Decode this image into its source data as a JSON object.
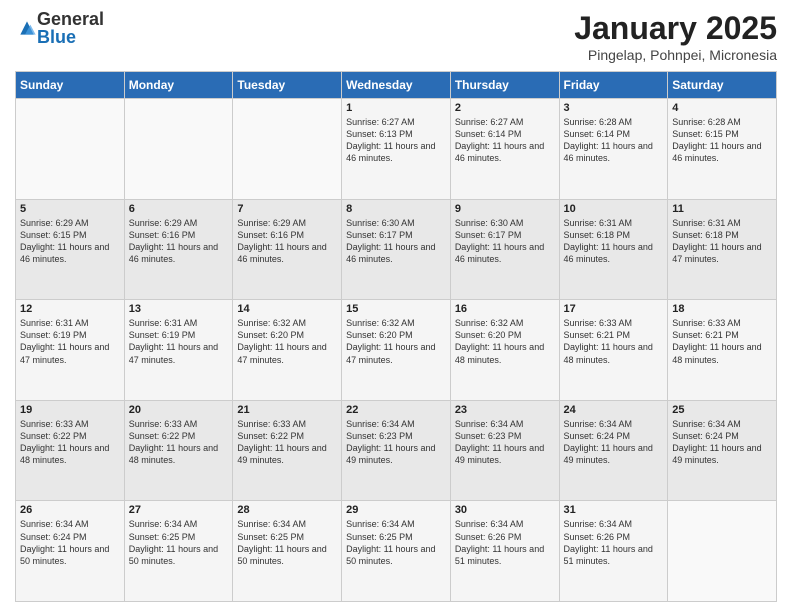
{
  "header": {
    "logo_general": "General",
    "logo_blue": "Blue",
    "title": "January 2025",
    "subtitle": "Pingelap, Pohnpei, Micronesia"
  },
  "weekdays": [
    "Sunday",
    "Monday",
    "Tuesday",
    "Wednesday",
    "Thursday",
    "Friday",
    "Saturday"
  ],
  "weeks": [
    [
      {
        "day": "",
        "info": ""
      },
      {
        "day": "",
        "info": ""
      },
      {
        "day": "",
        "info": ""
      },
      {
        "day": "1",
        "info": "Sunrise: 6:27 AM\nSunset: 6:13 PM\nDaylight: 11 hours and 46 minutes."
      },
      {
        "day": "2",
        "info": "Sunrise: 6:27 AM\nSunset: 6:14 PM\nDaylight: 11 hours and 46 minutes."
      },
      {
        "day": "3",
        "info": "Sunrise: 6:28 AM\nSunset: 6:14 PM\nDaylight: 11 hours and 46 minutes."
      },
      {
        "day": "4",
        "info": "Sunrise: 6:28 AM\nSunset: 6:15 PM\nDaylight: 11 hours and 46 minutes."
      }
    ],
    [
      {
        "day": "5",
        "info": "Sunrise: 6:29 AM\nSunset: 6:15 PM\nDaylight: 11 hours and 46 minutes."
      },
      {
        "day": "6",
        "info": "Sunrise: 6:29 AM\nSunset: 6:16 PM\nDaylight: 11 hours and 46 minutes."
      },
      {
        "day": "7",
        "info": "Sunrise: 6:29 AM\nSunset: 6:16 PM\nDaylight: 11 hours and 46 minutes."
      },
      {
        "day": "8",
        "info": "Sunrise: 6:30 AM\nSunset: 6:17 PM\nDaylight: 11 hours and 46 minutes."
      },
      {
        "day": "9",
        "info": "Sunrise: 6:30 AM\nSunset: 6:17 PM\nDaylight: 11 hours and 46 minutes."
      },
      {
        "day": "10",
        "info": "Sunrise: 6:31 AM\nSunset: 6:18 PM\nDaylight: 11 hours and 46 minutes."
      },
      {
        "day": "11",
        "info": "Sunrise: 6:31 AM\nSunset: 6:18 PM\nDaylight: 11 hours and 47 minutes."
      }
    ],
    [
      {
        "day": "12",
        "info": "Sunrise: 6:31 AM\nSunset: 6:19 PM\nDaylight: 11 hours and 47 minutes."
      },
      {
        "day": "13",
        "info": "Sunrise: 6:31 AM\nSunset: 6:19 PM\nDaylight: 11 hours and 47 minutes."
      },
      {
        "day": "14",
        "info": "Sunrise: 6:32 AM\nSunset: 6:20 PM\nDaylight: 11 hours and 47 minutes."
      },
      {
        "day": "15",
        "info": "Sunrise: 6:32 AM\nSunset: 6:20 PM\nDaylight: 11 hours and 47 minutes."
      },
      {
        "day": "16",
        "info": "Sunrise: 6:32 AM\nSunset: 6:20 PM\nDaylight: 11 hours and 48 minutes."
      },
      {
        "day": "17",
        "info": "Sunrise: 6:33 AM\nSunset: 6:21 PM\nDaylight: 11 hours and 48 minutes."
      },
      {
        "day": "18",
        "info": "Sunrise: 6:33 AM\nSunset: 6:21 PM\nDaylight: 11 hours and 48 minutes."
      }
    ],
    [
      {
        "day": "19",
        "info": "Sunrise: 6:33 AM\nSunset: 6:22 PM\nDaylight: 11 hours and 48 minutes."
      },
      {
        "day": "20",
        "info": "Sunrise: 6:33 AM\nSunset: 6:22 PM\nDaylight: 11 hours and 48 minutes."
      },
      {
        "day": "21",
        "info": "Sunrise: 6:33 AM\nSunset: 6:22 PM\nDaylight: 11 hours and 49 minutes."
      },
      {
        "day": "22",
        "info": "Sunrise: 6:34 AM\nSunset: 6:23 PM\nDaylight: 11 hours and 49 minutes."
      },
      {
        "day": "23",
        "info": "Sunrise: 6:34 AM\nSunset: 6:23 PM\nDaylight: 11 hours and 49 minutes."
      },
      {
        "day": "24",
        "info": "Sunrise: 6:34 AM\nSunset: 6:24 PM\nDaylight: 11 hours and 49 minutes."
      },
      {
        "day": "25",
        "info": "Sunrise: 6:34 AM\nSunset: 6:24 PM\nDaylight: 11 hours and 49 minutes."
      }
    ],
    [
      {
        "day": "26",
        "info": "Sunrise: 6:34 AM\nSunset: 6:24 PM\nDaylight: 11 hours and 50 minutes."
      },
      {
        "day": "27",
        "info": "Sunrise: 6:34 AM\nSunset: 6:25 PM\nDaylight: 11 hours and 50 minutes."
      },
      {
        "day": "28",
        "info": "Sunrise: 6:34 AM\nSunset: 6:25 PM\nDaylight: 11 hours and 50 minutes."
      },
      {
        "day": "29",
        "info": "Sunrise: 6:34 AM\nSunset: 6:25 PM\nDaylight: 11 hours and 50 minutes."
      },
      {
        "day": "30",
        "info": "Sunrise: 6:34 AM\nSunset: 6:26 PM\nDaylight: 11 hours and 51 minutes."
      },
      {
        "day": "31",
        "info": "Sunrise: 6:34 AM\nSunset: 6:26 PM\nDaylight: 11 hours and 51 minutes."
      },
      {
        "day": "",
        "info": ""
      }
    ]
  ]
}
